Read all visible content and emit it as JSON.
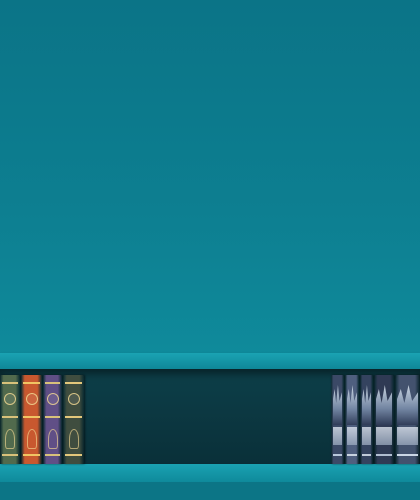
{
  "scene": {
    "wall_color": "#0b7487",
    "shelf_color": "#1aa3b3",
    "cavity_color": "#0a3039"
  },
  "books_left": [
    {
      "name": "shelf-book-1",
      "color": "#516a4d",
      "accent": "#d8c17a"
    },
    {
      "name": "shelf-book-2",
      "color": "#c8582f",
      "accent": "#f0c463"
    },
    {
      "name": "shelf-book-3",
      "color": "#604f86",
      "accent": "#d8c17a"
    },
    {
      "name": "shelf-book-4",
      "color": "#3f4d3f",
      "accent": "#e3c77b"
    }
  ],
  "books_right": [
    {
      "name": "shelf-book-5",
      "color": "#3b4966",
      "accent": "#b8c7da"
    },
    {
      "name": "shelf-book-6",
      "color": "#4f5f7f",
      "accent": "#c7d2df"
    },
    {
      "name": "shelf-book-7",
      "color": "#34435f",
      "accent": "#bfcad8"
    },
    {
      "name": "shelf-book-8",
      "color": "#2f3a54",
      "accent": "#b0bdd0"
    },
    {
      "name": "shelf-book-9",
      "color": "#43526e",
      "accent": "#cad6e5"
    }
  ]
}
